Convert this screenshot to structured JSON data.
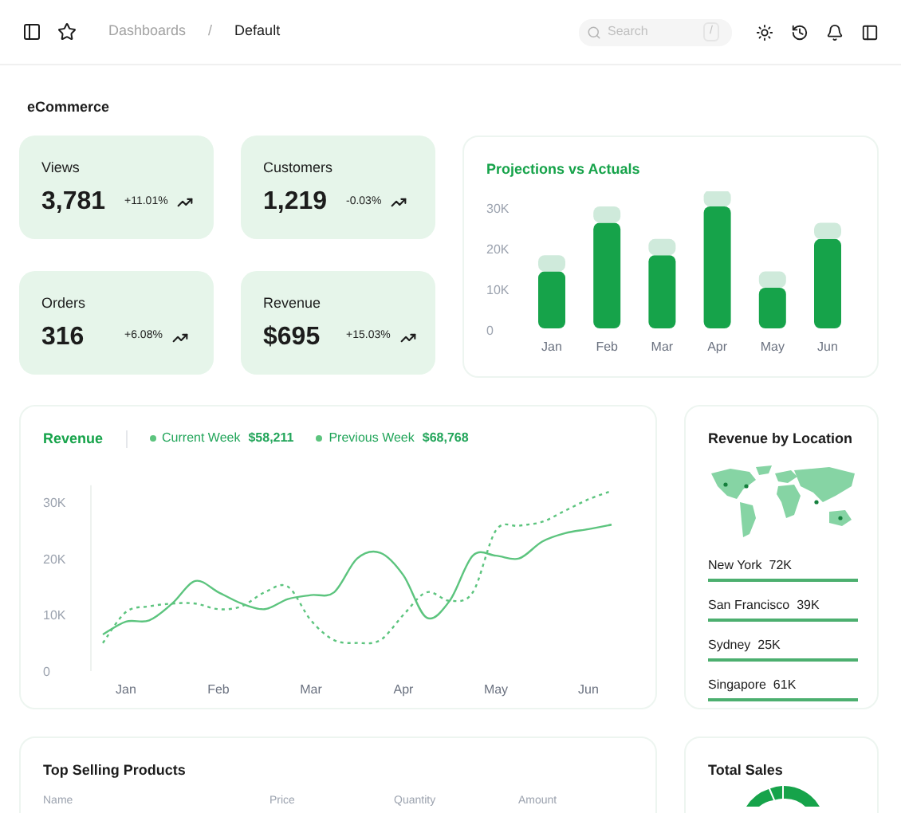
{
  "header": {
    "breadcrumbs": [
      {
        "label": "Dashboards",
        "selected": false
      },
      {
        "label": "Default",
        "selected": true
      }
    ],
    "separator": "/",
    "search": {
      "placeholder": "Search",
      "shortcut": "/"
    }
  },
  "page_title": "eCommerce",
  "stats": [
    {
      "label": "Views",
      "value": "3,781",
      "change": "+11.01%"
    },
    {
      "label": "Customers",
      "value": "1,219",
      "change": "-0.03%"
    },
    {
      "label": "Orders",
      "value": "316",
      "change": "+6.08%"
    },
    {
      "label": "Revenue",
      "value": "$695",
      "change": "+15.03%"
    }
  ],
  "projections": {
    "title": "Projections vs Actuals",
    "chart_data": {
      "type": "bar",
      "categories": [
        "Jan",
        "Feb",
        "Mar",
        "Apr",
        "May",
        "Jun"
      ],
      "stacked": true,
      "ylim": [
        0,
        35000
      ],
      "yticks": [
        {
          "value": 0,
          "label": "0"
        },
        {
          "value": 10000,
          "label": "10K"
        },
        {
          "value": 20000,
          "label": "20K"
        },
        {
          "value": 30000,
          "label": "30K"
        }
      ],
      "series": [
        {
          "color": "#16a34a",
          "values": [
            14000,
            26000,
            18000,
            30000,
            10000,
            22000
          ]
        },
        {
          "color": "#cfeadb",
          "values": [
            4000,
            4000,
            4000,
            4000,
            4000,
            4000
          ]
        }
      ]
    }
  },
  "revenue": {
    "title": "Revenue",
    "legend": [
      {
        "value": "$58,211"
      },
      {
        "value": "$68,768"
      }
    ],
    "chart_data": {
      "type": "line",
      "ylim": [
        0,
        33000
      ],
      "categories": [
        null,
        "Jan",
        null,
        null,
        null,
        "Feb",
        null,
        null,
        null,
        "Mar",
        null,
        null,
        null,
        "Apr",
        null,
        null,
        null,
        "May",
        null,
        null,
        null,
        "Jun",
        null
      ],
      "yticks": [
        {
          "value": 0,
          "label": "0"
        },
        {
          "value": 10000,
          "label": "10K"
        },
        {
          "value": 20000,
          "label": "20K"
        },
        {
          "value": 30000,
          "label": "30K"
        }
      ],
      "series": [
        {
          "name": "Current Week",
          "color": "#5cc47e",
          "values": [
            6500,
            8800,
            9000,
            12000,
            16000,
            14000,
            12000,
            11000,
            12800,
            13500,
            14000,
            20000,
            21000,
            17000,
            9500,
            12500,
            20500,
            20500,
            20000,
            23000,
            24500,
            25200,
            26000
          ]
        },
        {
          "name": "Previous Week",
          "color": "#5cc47e",
          "line_style": "dotted",
          "values": [
            5000,
            10500,
            11500,
            12000,
            12000,
            11000,
            11500,
            14000,
            15000,
            9000,
            5500,
            5000,
            5500,
            10000,
            14000,
            12500,
            14000,
            25000,
            25800,
            26500,
            28500,
            30500,
            32000
          ]
        }
      ]
    }
  },
  "locations": {
    "title": "Revenue by Location",
    "items": [
      {
        "label": "New York  72K",
        "level": 1
      },
      {
        "label": "San Francisco  39K",
        "level": 1
      },
      {
        "label": "Sydney  25K",
        "level": 1
      },
      {
        "label": "Singapore  61K",
        "level": 1
      }
    ]
  },
  "top_products": {
    "title": "Top Selling Products",
    "columns": [
      "Name",
      "Price",
      "Quantity",
      "Amount"
    ]
  },
  "total_sales": {
    "title": "Total Sales"
  }
}
